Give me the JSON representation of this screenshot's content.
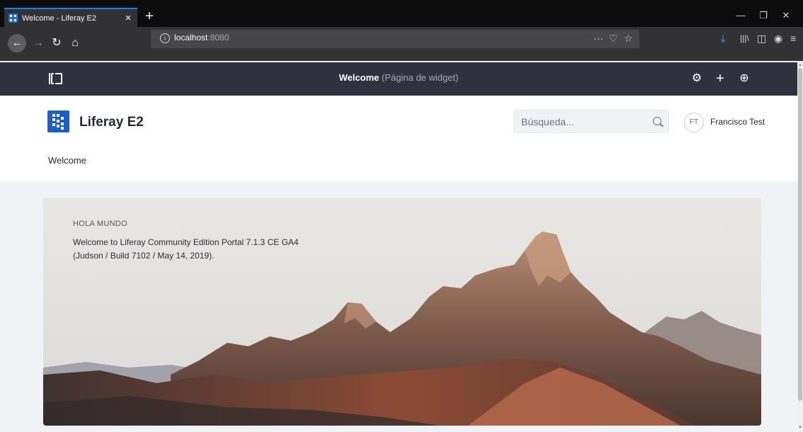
{
  "browser": {
    "tab_title": "Welcome - Liferay E2",
    "tab_close": "×",
    "new_tab": "+",
    "url_host": "localhost",
    "url_port": ":8080",
    "window_controls": {
      "minimize": "—",
      "restore": "❐",
      "close": "✕"
    },
    "icons": [
      "back-icon",
      "forward-icon",
      "reload-icon",
      "home-icon",
      "page-actions-icon",
      "pocket-icon",
      "bookmark-star-icon",
      "download-icon",
      "library-icon",
      "sidebar-icon",
      "account-icon",
      "menu-icon"
    ]
  },
  "control_menu": {
    "title": "Welcome",
    "subtitle": "(Página de widget)"
  },
  "header": {
    "site_name": "Liferay E2",
    "search_placeholder": "Búsqueda...",
    "user_initials": "FT",
    "user_name": "Francisco Test",
    "nav_items": [
      "Welcome"
    ]
  },
  "hero": {
    "kicker": "HOLA MUNDO",
    "line1": "Welcome to Liferay Community Edition Portal 7.1.3 CE GA4",
    "line2": "(Judson / Build 7102 / May 14, 2019)."
  },
  "colors": {
    "browser_bg": "#0c0c0d",
    "toolbar_bg": "#323234",
    "accent_blue": "#0a84ff",
    "control_menu_bg": "#30313f",
    "logo_blue": "#1e5ec8",
    "avatar_text": "#8a4ab4"
  }
}
